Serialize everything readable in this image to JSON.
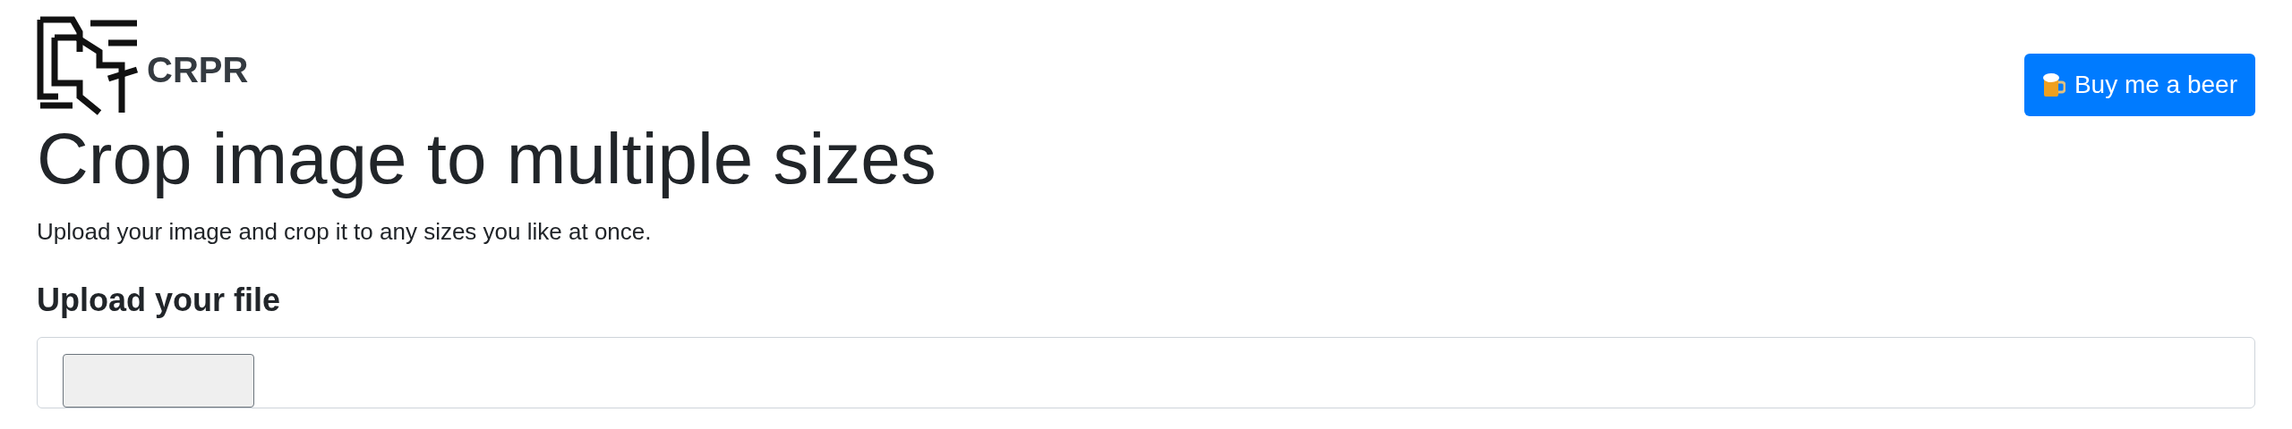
{
  "header": {
    "brand": "CRPR",
    "donate_button": "Buy me a beer"
  },
  "title": "Crop image to multiple sizes",
  "subtitle": "Upload your image and crop it to any sizes you like at once.",
  "upload": {
    "heading": "Upload your file"
  }
}
